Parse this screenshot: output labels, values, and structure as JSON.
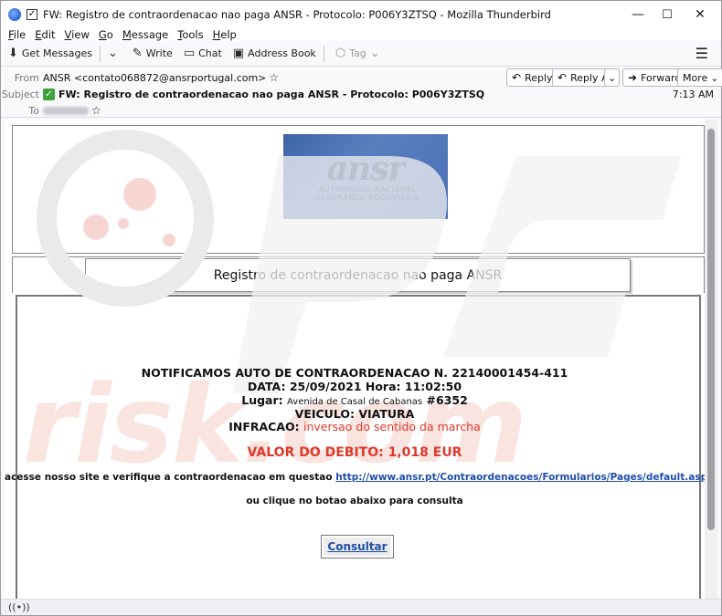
{
  "window": {
    "title": "FW: Registro de contraordenacao nao paga ANSR - Protocolo: P006Y3ZTSQ - Mozilla Thunderbird",
    "controls": {
      "minimize": "—",
      "maximize": "☐",
      "close": "✕"
    }
  },
  "menubar": [
    "File",
    "Edit",
    "View",
    "Go",
    "Message",
    "Tools",
    "Help"
  ],
  "toolbar": {
    "get_messages": "Get Messages",
    "write": "Write",
    "chat": "Chat",
    "address_book": "Address Book",
    "tag": "Tag"
  },
  "header": {
    "from_label": "From",
    "from_value": "ANSR <contato068872@ansrportugal.com>",
    "subject_label": "Subject",
    "subject_value": "FW: Registro de contraordenacao nao paga ANSR - Protocolo: P006Y3ZTSQ",
    "to_label": "To",
    "time": "7:13 AM",
    "buttons": {
      "reply": "Reply",
      "reply_all": "Reply All",
      "forward": "Forward",
      "more": "More"
    }
  },
  "email": {
    "banner_logo": "ansr",
    "banner_sub_1": "AUTORIDADE NACIONAL",
    "banner_sub_2": "SEGURANÇA RODOVIÁRIA",
    "heading": "Registro de contraordenacao nao paga ANSR",
    "line_notice": "NOTIFICAMOS AUTO DE CONTRAORDENACAO N. 22140001454-411",
    "line_date": "DATA: 25/09/2021 Hora: 11:02:50",
    "lugar_label": "Lugar:",
    "lugar_address": "Avenida de Casal de Cabanas",
    "lugar_number": "#6352",
    "line_vehicle": "VEICULO: VIATURA",
    "infracao_label": "INFRACAO:",
    "infracao_value": "inversao do sentido da marcha",
    "valor": "VALOR DO DEBITO: 1,018 EUR",
    "access_text": "acesse nosso site e verifique a contraordenacao em questao",
    "access_link": "http://www.ansr.pt/Contraordenacoes/Formularios/Pages/default.aspx",
    "or_click": "ou clique no botao abaixo para consulta",
    "consult_button": "Consultar"
  },
  "watermark": "risk.com",
  "colors": {
    "alert_red": "#e0382a",
    "link_blue": "#1e4fa8",
    "banner_blue": "#4a6fb3"
  }
}
